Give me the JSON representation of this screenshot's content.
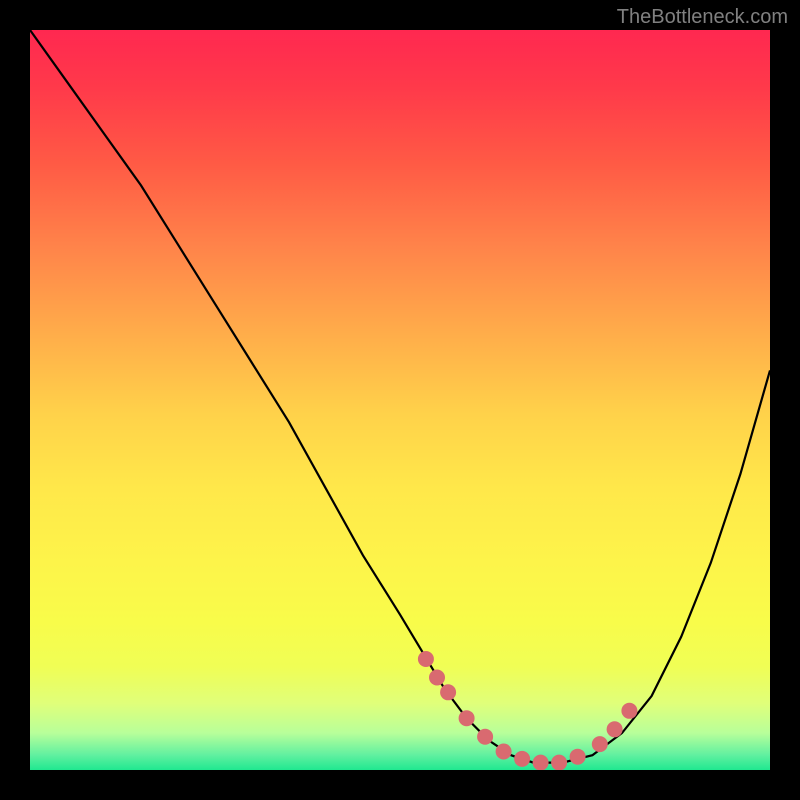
{
  "watermark": "TheBottleneck.com",
  "chart_data": {
    "type": "line",
    "title": "",
    "xlabel": "",
    "ylabel": "",
    "xlim": [
      0,
      100
    ],
    "ylim": [
      0,
      100
    ],
    "curve": {
      "name": "bottleneck-curve",
      "x": [
        0,
        5,
        10,
        15,
        20,
        25,
        30,
        35,
        40,
        45,
        50,
        53,
        56,
        59,
        62,
        65,
        68,
        72,
        76,
        80,
        84,
        88,
        92,
        96,
        100
      ],
      "y": [
        100,
        93,
        86,
        79,
        71,
        63,
        55,
        47,
        38,
        29,
        21,
        16,
        11,
        7,
        4,
        2,
        1,
        1,
        2,
        5,
        10,
        18,
        28,
        40,
        54
      ]
    },
    "dots": {
      "name": "highlight-dots",
      "x": [
        53.5,
        55.0,
        56.5,
        59.0,
        61.5,
        64.0,
        66.5,
        69.0,
        71.5,
        74.0,
        77.0,
        79.0,
        81.0
      ],
      "y": [
        15.0,
        12.5,
        10.5,
        7.0,
        4.5,
        2.5,
        1.5,
        1.0,
        1.0,
        1.8,
        3.5,
        5.5,
        8.0
      ]
    }
  }
}
